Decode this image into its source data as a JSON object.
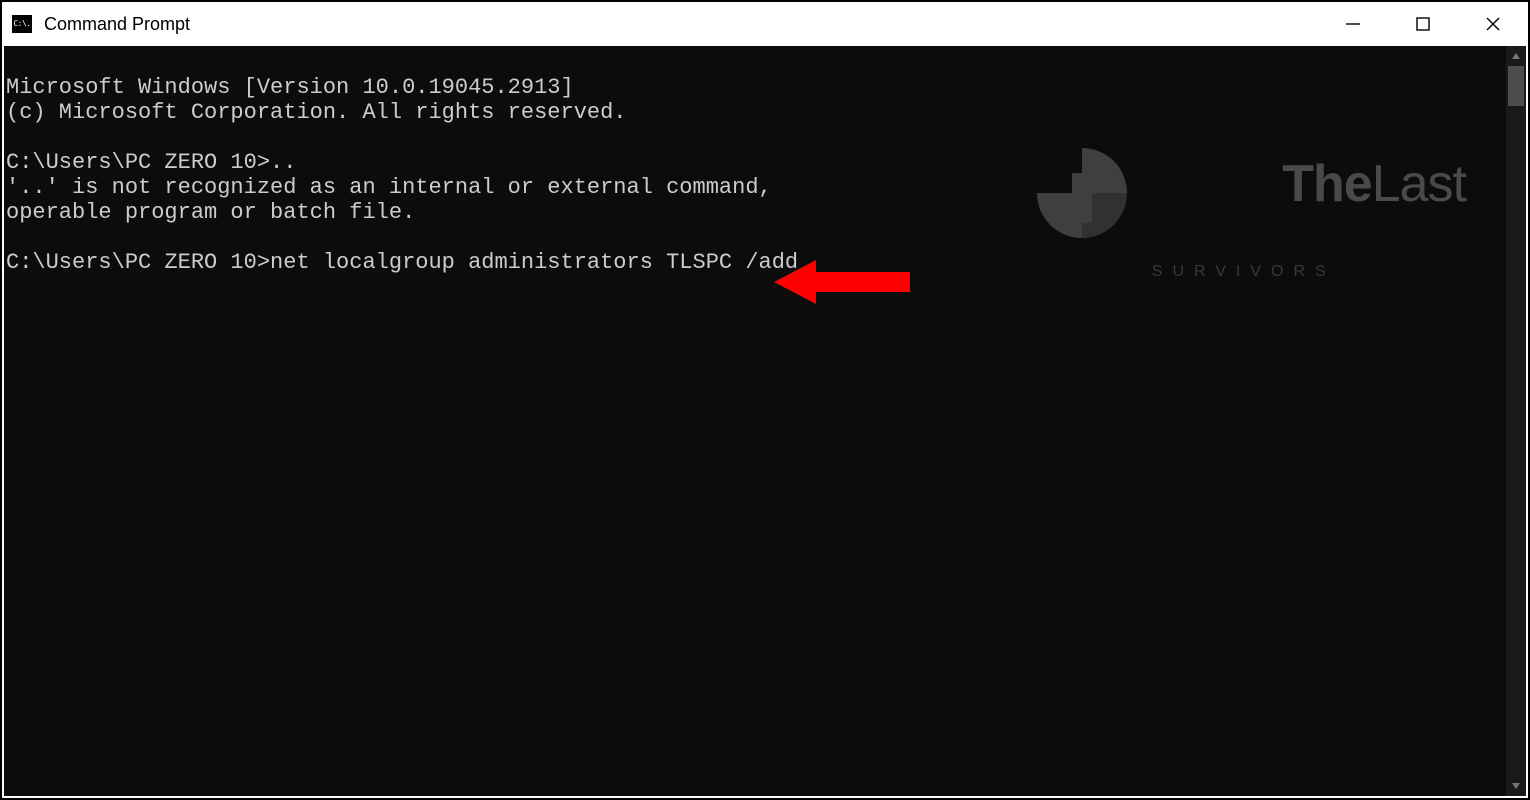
{
  "window": {
    "title": "Command Prompt",
    "icon_text": "C:\\."
  },
  "terminal": {
    "lines": [
      "Microsoft Windows [Version 10.0.19045.2913]",
      "(c) Microsoft Corporation. All rights reserved.",
      "",
      "C:\\Users\\PC ZERO 10>..",
      "'..' is not recognized as an internal or external command,",
      "operable program or batch file.",
      "",
      "C:\\Users\\PC ZERO 10>net localgroup administrators TLSPC /add"
    ],
    "highlight_line_index": 7
  },
  "watermark": {
    "brand_strong": "The",
    "brand_light": "Last",
    "tagline": "SURVIVORS"
  },
  "colors": {
    "terminal_bg": "#0c0c0c",
    "scrollbar_thumb": "#4d4d4d",
    "annotation": "#ff0000"
  }
}
